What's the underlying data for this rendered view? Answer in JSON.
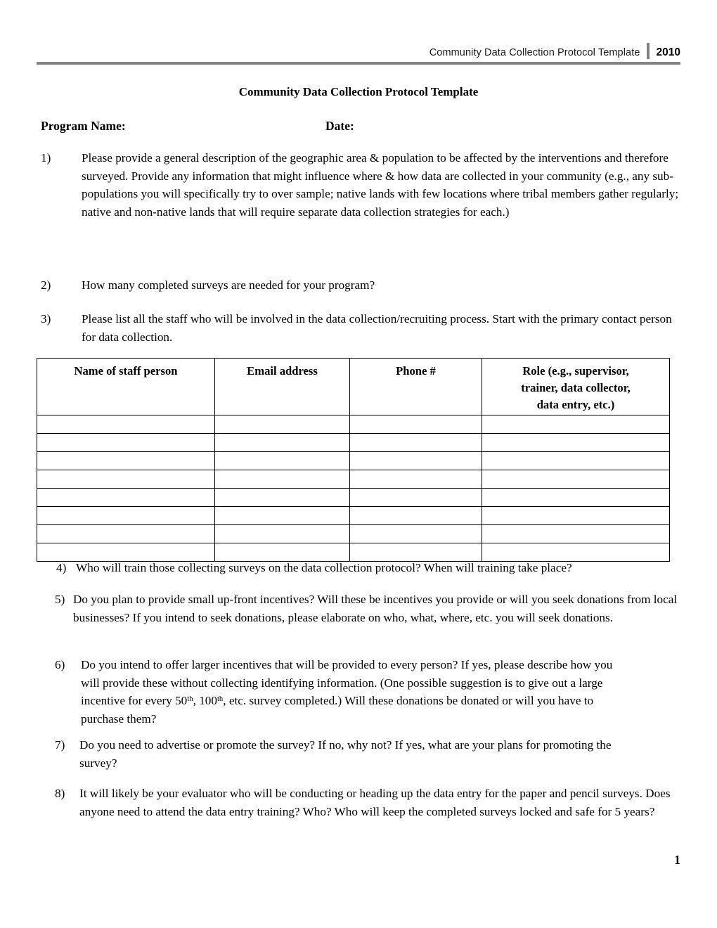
{
  "header": {
    "title": "Community Data Collection Protocol Template",
    "year": "2010"
  },
  "document": {
    "title": "Community Data Collection Protocol Template",
    "page_number": "1"
  },
  "fields": {
    "program_name_label": "Program Name:",
    "date_label": "Date:"
  },
  "questions": [
    {
      "number": "1)",
      "text": "Please provide a general description of the geographic area & population to be affected by the interventions and therefore surveyed.  Provide any information that might influence where & how data are collected in your community (e.g., any sub-populations you will specifically try to over sample; native lands with few locations where tribal members gather regularly; native and non-native lands that will require separate data collection strategies for each.)"
    },
    {
      "number": "2)",
      "text": "How many completed surveys are needed for your program?"
    },
    {
      "number": "3)",
      "text": "Please list all the staff who will be involved in the data collection/recruiting process. Start with the primary contact person for data collection."
    },
    {
      "number": "4)",
      "text": "Who will train those collecting surveys on the data collection protocol?  When will training take place?"
    },
    {
      "number": "5)",
      "text": "Do you plan to provide small up-front incentives?  Will these be incentives you provide or will you seek donations from local businesses?  If you intend to seek donations, please elaborate on  who, what, where, etc. you will seek donations."
    },
    {
      "number": "6)",
      "text_part_1": "Do you intend to offer larger incentives that will be provided to every person?  If yes, please describe how you will provide these without collecting identifying information.  (One possible suggestion is to give out a large incentive for every 50",
      "sup_1": "th",
      "text_part_2": ", 100",
      "sup_2": "th",
      "text_part_3": ", etc. survey completed.)  Will these donations be donated or will you have to purchase them?"
    },
    {
      "number": "7)",
      "text": "Do you need to advertise or promote the survey? If no, why not?  If yes, what are your plans for promoting the survey?"
    },
    {
      "number": "8)",
      "text": "It will likely be your evaluator who will be conducting or heading up the data entry for the paper and pencil surveys. Does anyone need to attend the data entry training?  Who?  Who will keep the completed surveys locked and safe for 5 years?"
    }
  ],
  "staff_table": {
    "columns": [
      "Name of staff person",
      "Email address",
      "Phone #",
      "Role (e.g., supervisor, trainer, data collector, data entry, etc.)"
    ],
    "column_role_lines": [
      "Role (e.g., supervisor,",
      "trainer, data collector,",
      "data entry, etc.)"
    ],
    "empty_row_count": 8
  },
  "colors": {
    "header_rule": "#848484",
    "header_divider": "#808080",
    "text": "#000000",
    "table_border": "#000000"
  }
}
